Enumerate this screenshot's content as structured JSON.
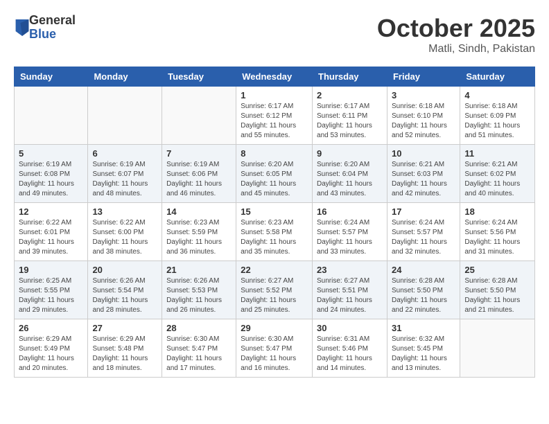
{
  "header": {
    "logo_general": "General",
    "logo_blue": "Blue",
    "month": "October 2025",
    "location": "Matli, Sindh, Pakistan"
  },
  "days_of_week": [
    "Sunday",
    "Monday",
    "Tuesday",
    "Wednesday",
    "Thursday",
    "Friday",
    "Saturday"
  ],
  "weeks": [
    [
      {
        "day": "",
        "info": ""
      },
      {
        "day": "",
        "info": ""
      },
      {
        "day": "",
        "info": ""
      },
      {
        "day": "1",
        "info": "Sunrise: 6:17 AM\nSunset: 6:12 PM\nDaylight: 11 hours and 55 minutes."
      },
      {
        "day": "2",
        "info": "Sunrise: 6:17 AM\nSunset: 6:11 PM\nDaylight: 11 hours and 53 minutes."
      },
      {
        "day": "3",
        "info": "Sunrise: 6:18 AM\nSunset: 6:10 PM\nDaylight: 11 hours and 52 minutes."
      },
      {
        "day": "4",
        "info": "Sunrise: 6:18 AM\nSunset: 6:09 PM\nDaylight: 11 hours and 51 minutes."
      }
    ],
    [
      {
        "day": "5",
        "info": "Sunrise: 6:19 AM\nSunset: 6:08 PM\nDaylight: 11 hours and 49 minutes."
      },
      {
        "day": "6",
        "info": "Sunrise: 6:19 AM\nSunset: 6:07 PM\nDaylight: 11 hours and 48 minutes."
      },
      {
        "day": "7",
        "info": "Sunrise: 6:19 AM\nSunset: 6:06 PM\nDaylight: 11 hours and 46 minutes."
      },
      {
        "day": "8",
        "info": "Sunrise: 6:20 AM\nSunset: 6:05 PM\nDaylight: 11 hours and 45 minutes."
      },
      {
        "day": "9",
        "info": "Sunrise: 6:20 AM\nSunset: 6:04 PM\nDaylight: 11 hours and 43 minutes."
      },
      {
        "day": "10",
        "info": "Sunrise: 6:21 AM\nSunset: 6:03 PM\nDaylight: 11 hours and 42 minutes."
      },
      {
        "day": "11",
        "info": "Sunrise: 6:21 AM\nSunset: 6:02 PM\nDaylight: 11 hours and 40 minutes."
      }
    ],
    [
      {
        "day": "12",
        "info": "Sunrise: 6:22 AM\nSunset: 6:01 PM\nDaylight: 11 hours and 39 minutes."
      },
      {
        "day": "13",
        "info": "Sunrise: 6:22 AM\nSunset: 6:00 PM\nDaylight: 11 hours and 38 minutes."
      },
      {
        "day": "14",
        "info": "Sunrise: 6:23 AM\nSunset: 5:59 PM\nDaylight: 11 hours and 36 minutes."
      },
      {
        "day": "15",
        "info": "Sunrise: 6:23 AM\nSunset: 5:58 PM\nDaylight: 11 hours and 35 minutes."
      },
      {
        "day": "16",
        "info": "Sunrise: 6:24 AM\nSunset: 5:57 PM\nDaylight: 11 hours and 33 minutes."
      },
      {
        "day": "17",
        "info": "Sunrise: 6:24 AM\nSunset: 5:57 PM\nDaylight: 11 hours and 32 minutes."
      },
      {
        "day": "18",
        "info": "Sunrise: 6:24 AM\nSunset: 5:56 PM\nDaylight: 11 hours and 31 minutes."
      }
    ],
    [
      {
        "day": "19",
        "info": "Sunrise: 6:25 AM\nSunset: 5:55 PM\nDaylight: 11 hours and 29 minutes."
      },
      {
        "day": "20",
        "info": "Sunrise: 6:26 AM\nSunset: 5:54 PM\nDaylight: 11 hours and 28 minutes."
      },
      {
        "day": "21",
        "info": "Sunrise: 6:26 AM\nSunset: 5:53 PM\nDaylight: 11 hours and 26 minutes."
      },
      {
        "day": "22",
        "info": "Sunrise: 6:27 AM\nSunset: 5:52 PM\nDaylight: 11 hours and 25 minutes."
      },
      {
        "day": "23",
        "info": "Sunrise: 6:27 AM\nSunset: 5:51 PM\nDaylight: 11 hours and 24 minutes."
      },
      {
        "day": "24",
        "info": "Sunrise: 6:28 AM\nSunset: 5:50 PM\nDaylight: 11 hours and 22 minutes."
      },
      {
        "day": "25",
        "info": "Sunrise: 6:28 AM\nSunset: 5:50 PM\nDaylight: 11 hours and 21 minutes."
      }
    ],
    [
      {
        "day": "26",
        "info": "Sunrise: 6:29 AM\nSunset: 5:49 PM\nDaylight: 11 hours and 20 minutes."
      },
      {
        "day": "27",
        "info": "Sunrise: 6:29 AM\nSunset: 5:48 PM\nDaylight: 11 hours and 18 minutes."
      },
      {
        "day": "28",
        "info": "Sunrise: 6:30 AM\nSunset: 5:47 PM\nDaylight: 11 hours and 17 minutes."
      },
      {
        "day": "29",
        "info": "Sunrise: 6:30 AM\nSunset: 5:47 PM\nDaylight: 11 hours and 16 minutes."
      },
      {
        "day": "30",
        "info": "Sunrise: 6:31 AM\nSunset: 5:46 PM\nDaylight: 11 hours and 14 minutes."
      },
      {
        "day": "31",
        "info": "Sunrise: 6:32 AM\nSunset: 5:45 PM\nDaylight: 11 hours and 13 minutes."
      },
      {
        "day": "",
        "info": ""
      }
    ]
  ]
}
